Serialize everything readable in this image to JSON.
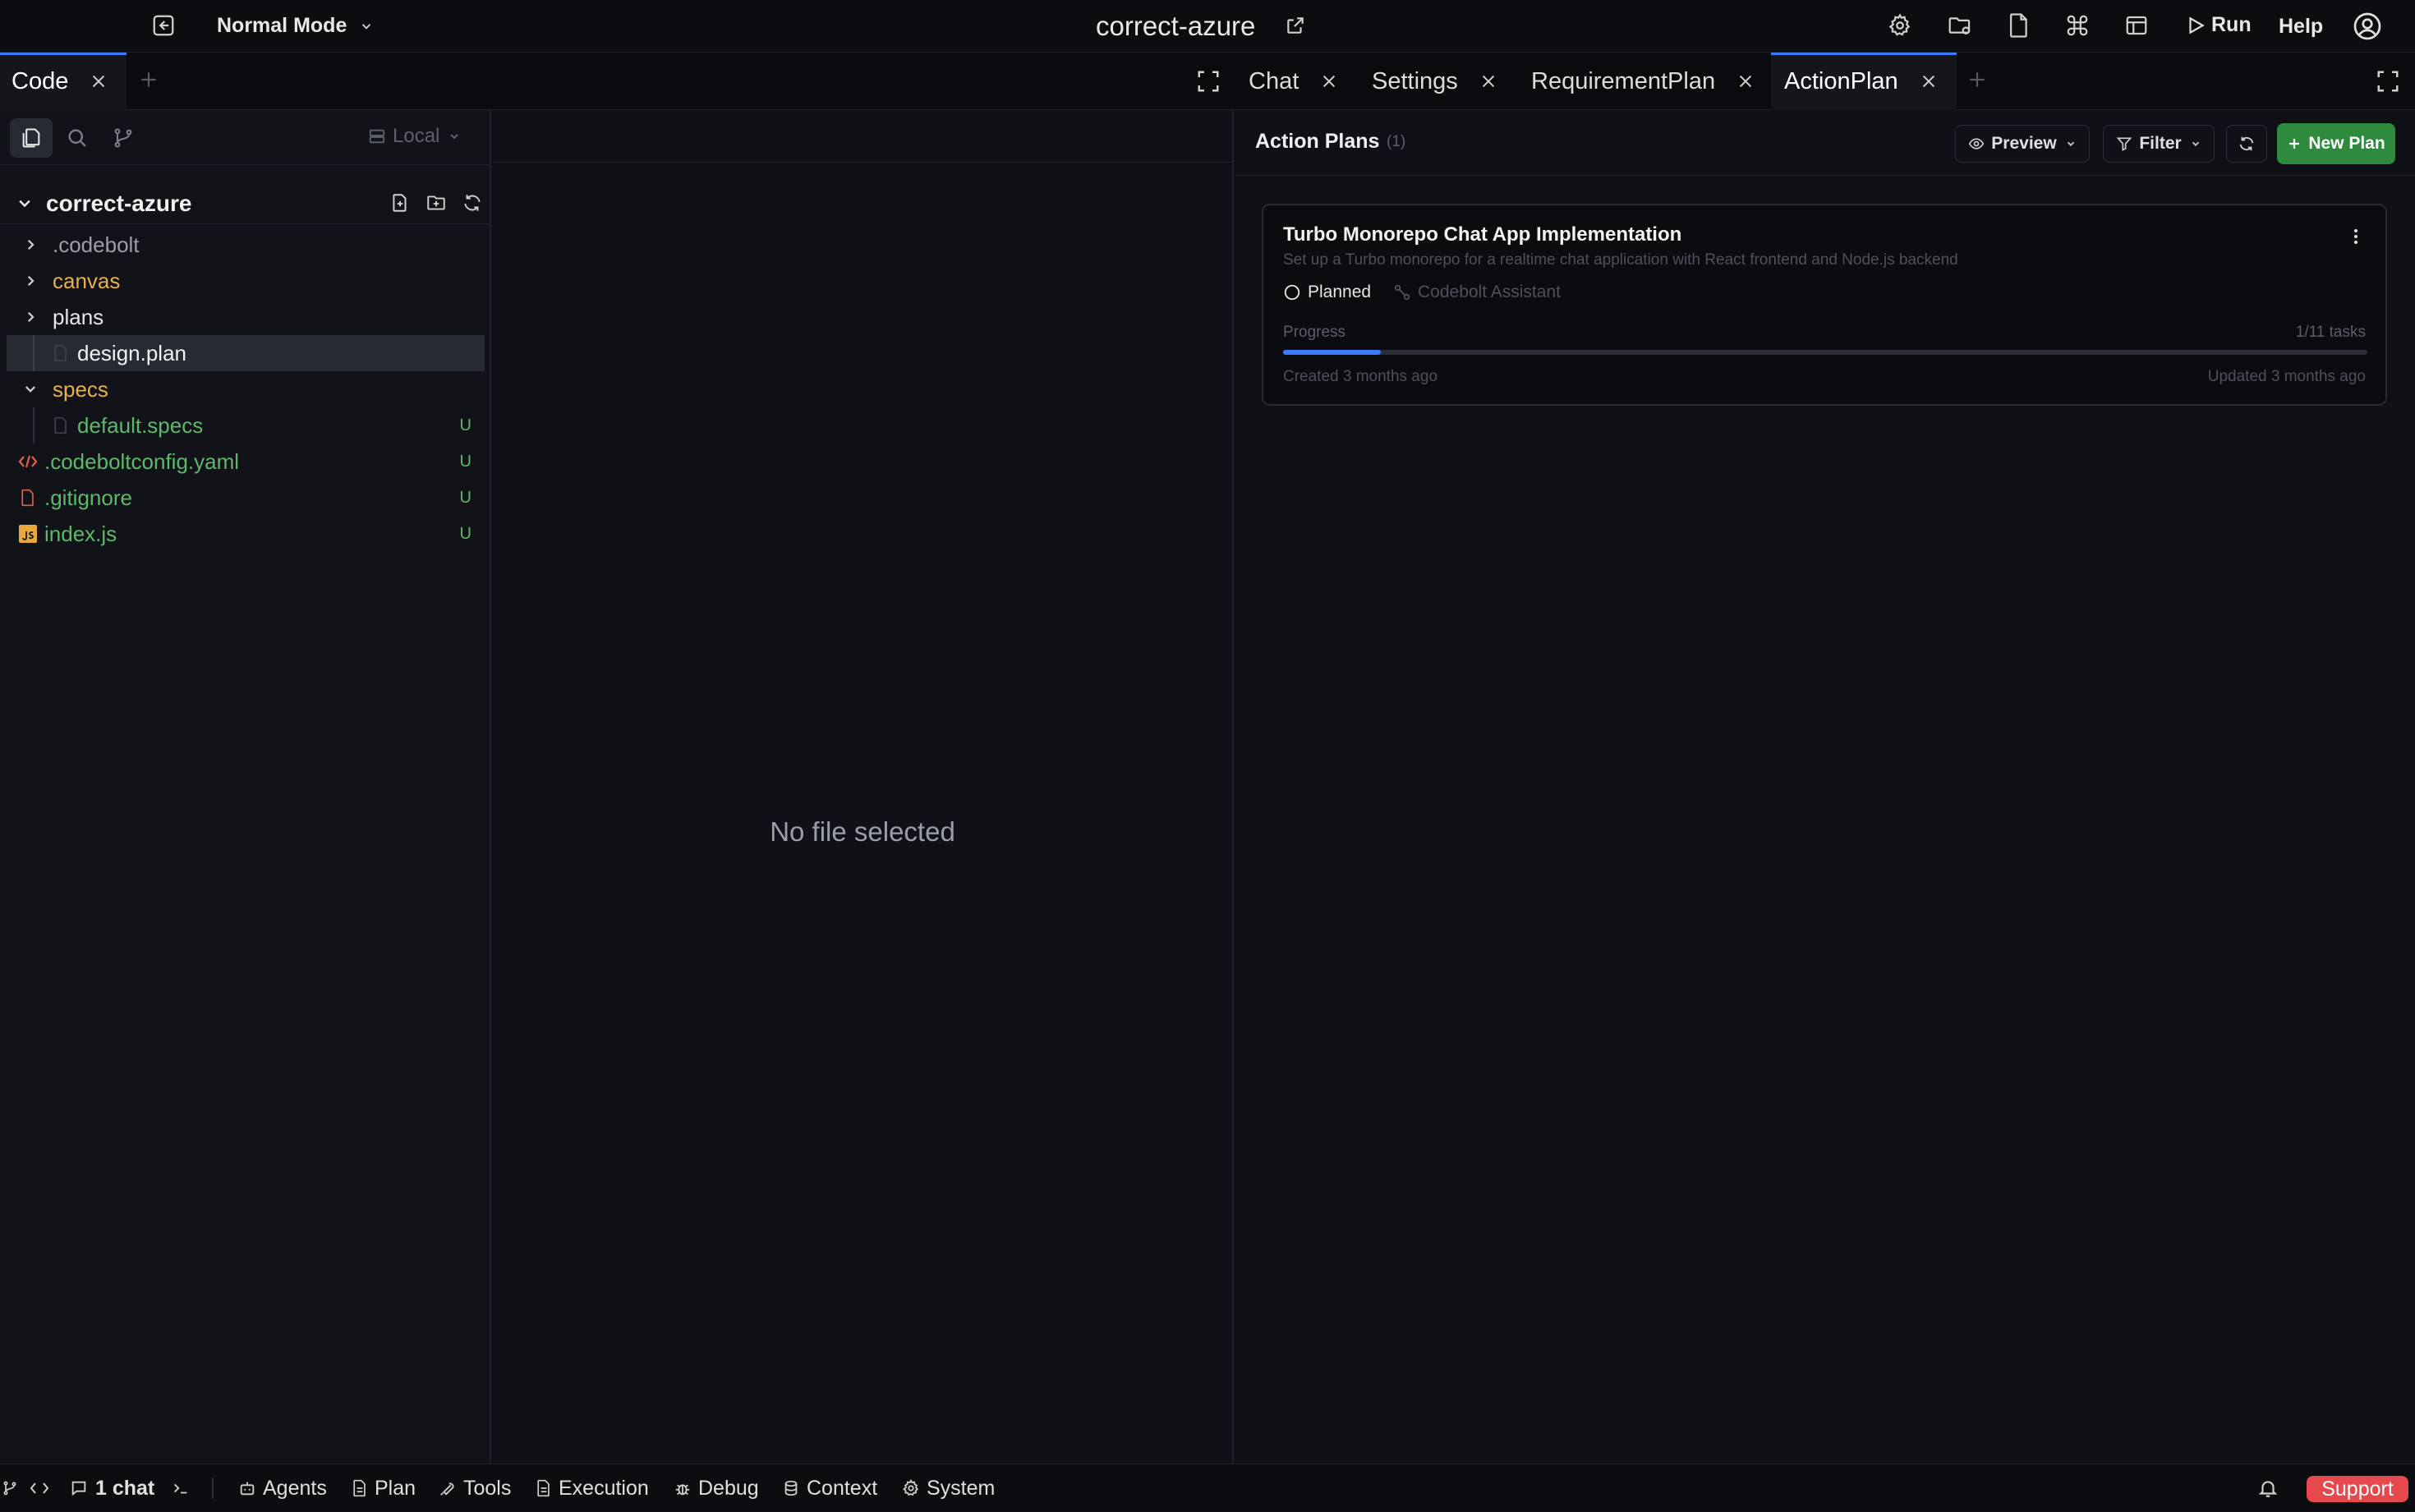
{
  "topbar": {
    "mode_label": "Normal Mode",
    "project_title": "correct-azure",
    "run_label": "Run",
    "help_label": "Help"
  },
  "left_tabs": [
    {
      "label": "Code"
    }
  ],
  "right_tabs": [
    {
      "label": "Chat"
    },
    {
      "label": "Settings"
    },
    {
      "label": "RequirementPlan"
    },
    {
      "label": "ActionPlan",
      "active": true
    }
  ],
  "sidebar": {
    "branch_label": "Local",
    "root_folder": "correct-azure",
    "items": [
      {
        "label": ".codebolt",
        "type": "folder",
        "state": "collapsed",
        "color": "#9aa0a6"
      },
      {
        "label": "canvas",
        "type": "folder",
        "state": "collapsed",
        "color": "#e8b04a"
      },
      {
        "label": "plans",
        "type": "folder",
        "state": "collapsed",
        "color": "#e6e6e6"
      },
      {
        "label": "design.plan",
        "type": "file",
        "selected": true,
        "color": "#e6e6e6"
      },
      {
        "label": "specs",
        "type": "folder",
        "state": "expanded",
        "color": "#e8b04a"
      },
      {
        "label": "default.specs",
        "type": "file",
        "status": "U",
        "color": "#5fb86a"
      },
      {
        "label": ".codeboltconfig.yaml",
        "type": "file",
        "status": "U",
        "color": "#5fb86a"
      },
      {
        "label": ".gitignore",
        "type": "file",
        "status": "U",
        "color": "#5fb86a"
      },
      {
        "label": "index.js",
        "type": "file",
        "status": "U",
        "color": "#5fb86a"
      }
    ]
  },
  "editor": {
    "empty_message": "No file selected"
  },
  "action_plans": {
    "title": "Action Plans",
    "count": "(1)",
    "preview_label": "Preview",
    "filter_label": "Filter",
    "new_plan_label": "New Plan",
    "plans": [
      {
        "title": "Turbo Monorepo Chat App Implementation",
        "description": "Set up a Turbo monorepo for a realtime chat application with React frontend and Node.js backend",
        "status": "Planned",
        "assignee": "Codebolt Assistant",
        "progress_label": "Progress",
        "tasks_label": "1/11 tasks",
        "progress_fraction": 0.09,
        "created": "Created 3 months ago",
        "updated": "Updated 3 months ago"
      }
    ]
  },
  "bottombar": {
    "chat_count": "1 chat",
    "items": [
      "Agents",
      "Plan",
      "Tools",
      "Execution",
      "Debug",
      "Context",
      "System"
    ],
    "support_label": "Support"
  },
  "colors": {
    "accent": "#3a7bff",
    "new_plan_bg": "#2e8b3e",
    "support_bg": "#e5484d",
    "untracked": "#5fb86a",
    "folder": "#e8b04a"
  }
}
